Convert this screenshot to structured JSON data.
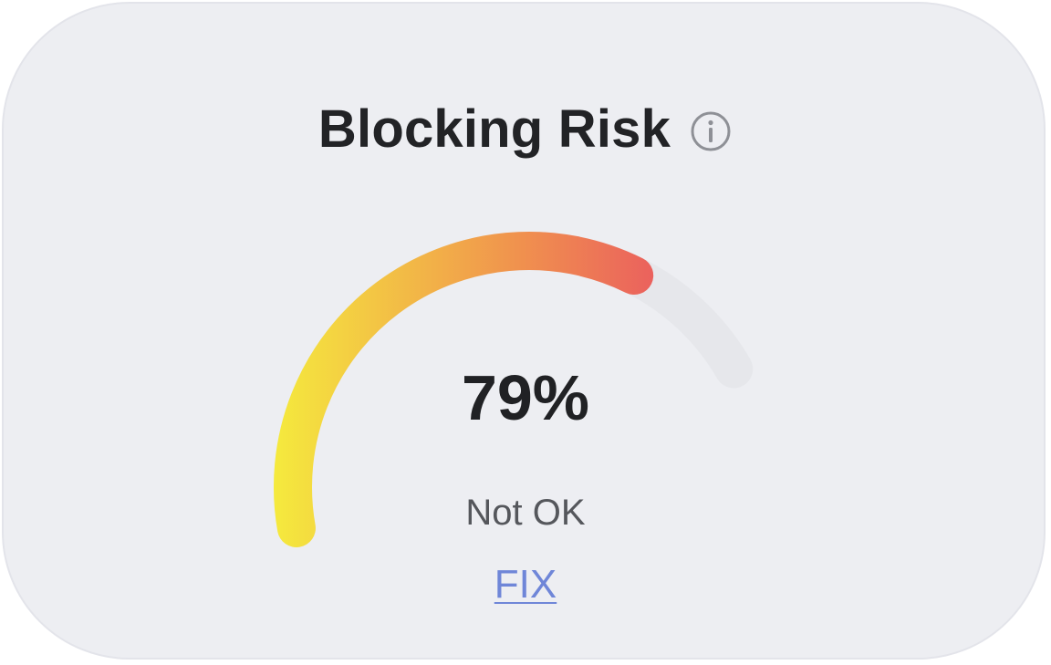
{
  "card": {
    "title": "Blocking Risk",
    "info_icon": "info-circle-icon"
  },
  "gauge": {
    "value_percent": 79,
    "value_label": "79%",
    "status_label": "Not OK",
    "gradient_start_color": "#f5ea3d",
    "gradient_mid_color": "#f0914e",
    "gradient_end_color": "#e6396a",
    "track_color": "#e6e7eb"
  },
  "actions": {
    "fix_label": "FIX",
    "link_color": "#6f86d8"
  }
}
